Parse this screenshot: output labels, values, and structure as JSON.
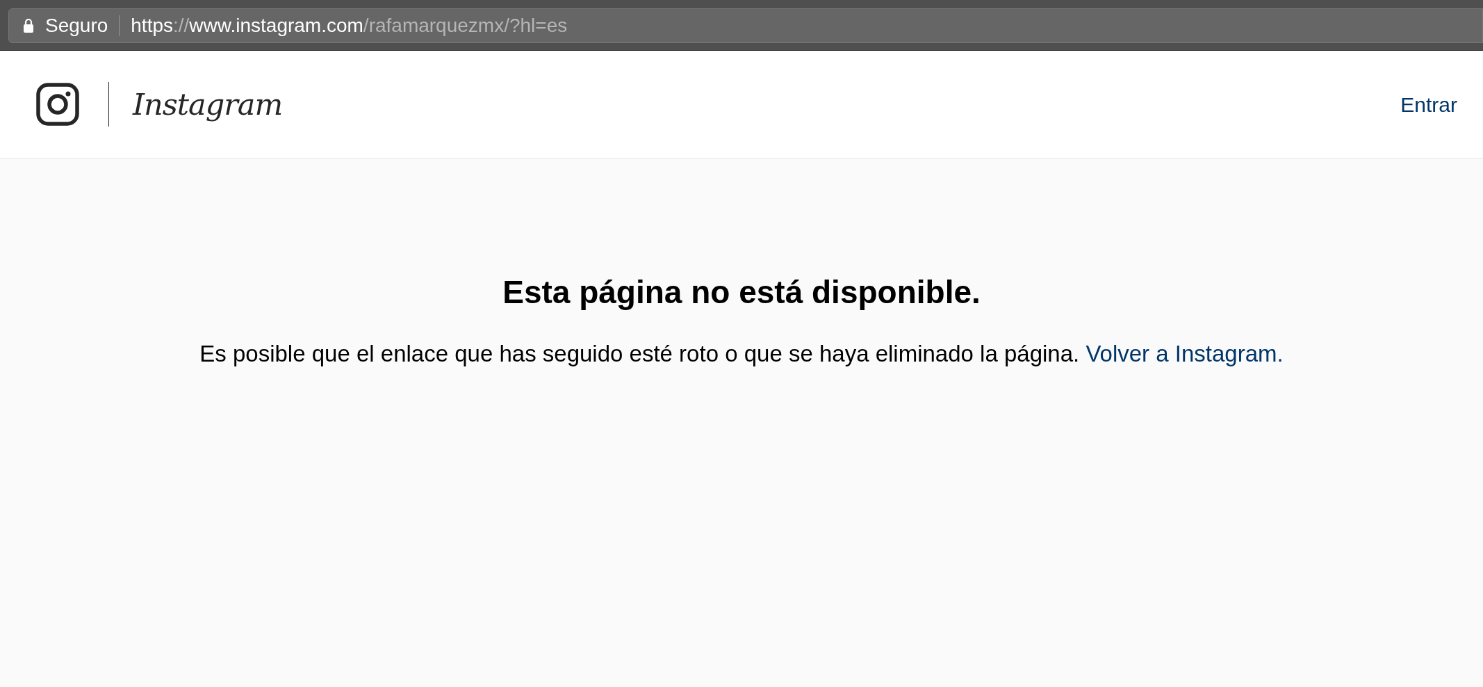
{
  "browser": {
    "security_label": "Seguro",
    "url_parts": [
      {
        "text": "https",
        "dim": false
      },
      {
        "text": "://",
        "dim": true
      },
      {
        "text": "www.instagram.com",
        "dim": false
      },
      {
        "text": "/rafamarquezmx/?hl=es",
        "dim": true
      }
    ]
  },
  "header": {
    "wordmark": "Instagram",
    "login_link": "Entrar"
  },
  "error": {
    "title": "Esta página no está disponible.",
    "message": "Es posible que el enlace que has seguido esté roto o que se haya eliminado la página.",
    "back_link": "Volver a Instagram."
  }
}
